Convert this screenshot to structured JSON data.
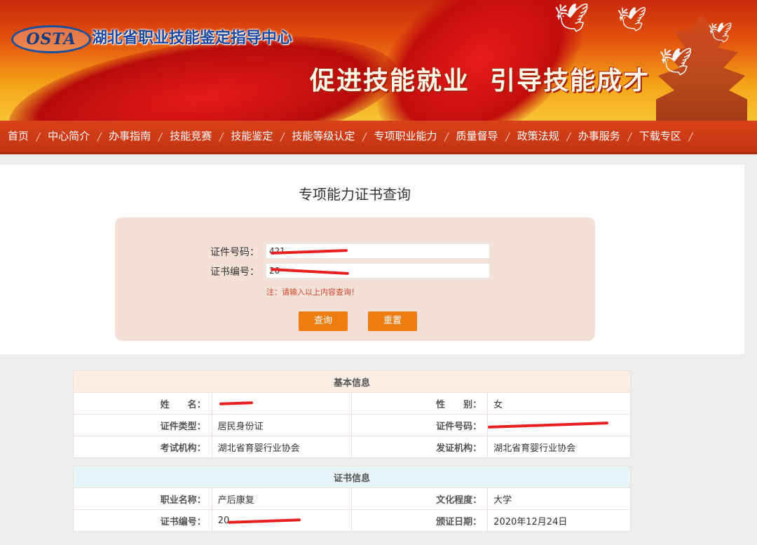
{
  "header": {
    "logo_text": "OSTA",
    "org_name": "湖北省职业技能鉴定指导中心",
    "slogan": "促进技能就业  引导技能成才"
  },
  "nav": {
    "items": [
      "首页",
      "中心简介",
      "办事指南",
      "技能竞赛",
      "技能鉴定",
      "技能等级认定",
      "专项职业能力",
      "质量督导",
      "政策法规",
      "办事服务",
      "下载专区"
    ]
  },
  "query": {
    "title": "专项能力证书查询",
    "id_label": "证件号码：",
    "id_value": "421",
    "cert_label": "证书编号：",
    "cert_value": "20",
    "note": "注：请输入以上内容查询！",
    "search_button": "查询",
    "reset_button": "重置"
  },
  "basic": {
    "header": "基本信息",
    "name_label": "姓　　名：",
    "name_value": "",
    "gender_label": "性　　别：",
    "gender_value": "女",
    "idtype_label": "证件类型：",
    "idtype_value": "居民身份证",
    "idno_label": "证件号码：",
    "idno_value": "",
    "exam_org_label": "考试机构：",
    "exam_org_value": "湖北省育婴行业协会",
    "issue_org_label": "发证机构：",
    "issue_org_value": "湖北省育婴行业协会"
  },
  "cert": {
    "header": "证书信息",
    "job_label": "职业名称：",
    "job_value": "产后康复",
    "edu_label": "文化程度：",
    "edu_value": "大学",
    "certno_label": "证书编号：",
    "certno_value": "20",
    "date_label": "颁证日期：",
    "date_value": "2020年12月24日"
  }
}
